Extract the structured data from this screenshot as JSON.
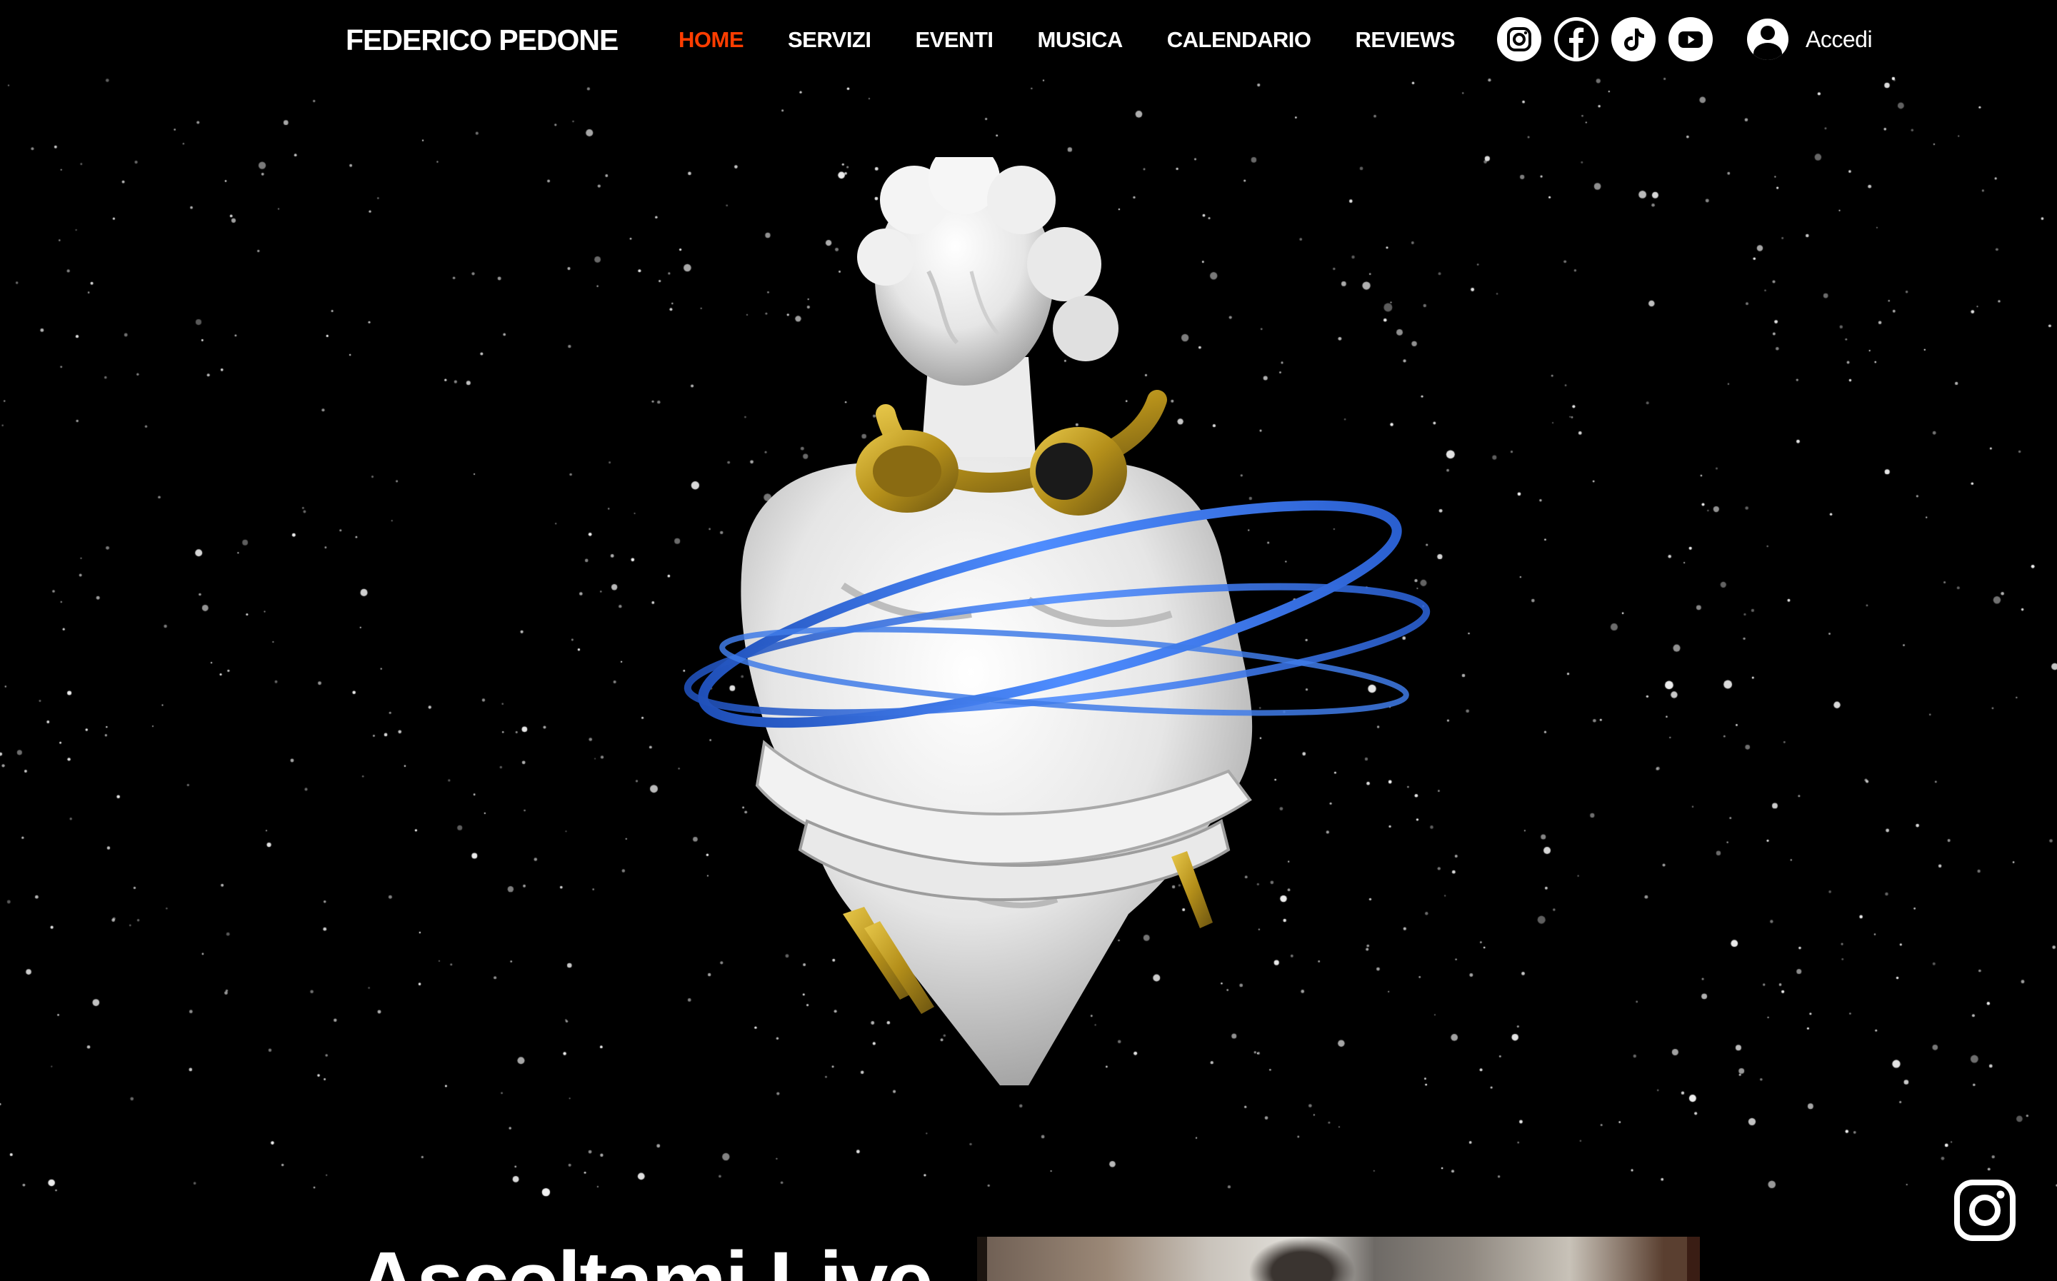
{
  "header": {
    "brand": "FEDERICO PEDONE",
    "nav": [
      {
        "label": "HOME",
        "active": true
      },
      {
        "label": "SERVIZI",
        "active": false
      },
      {
        "label": "EVENTI",
        "active": false
      },
      {
        "label": "MUSICA",
        "active": false
      },
      {
        "label": "CALENDARIO",
        "active": false
      },
      {
        "label": "REVIEWS",
        "active": false
      }
    ],
    "socials": [
      "instagram-icon",
      "facebook-icon",
      "tiktok-icon",
      "youtube-icon"
    ],
    "login_label": "Accedi"
  },
  "hero": {
    "art": "statue-bust-with-headphones-and-blue-rings"
  },
  "section": {
    "title": "Ascoltami Live"
  },
  "floating_button": "instagram-icon",
  "colors": {
    "background": "#000000",
    "text": "#ffffff",
    "accent": "#ff3d00",
    "headphones": "#c9a227",
    "rings": "#3f7be8"
  }
}
